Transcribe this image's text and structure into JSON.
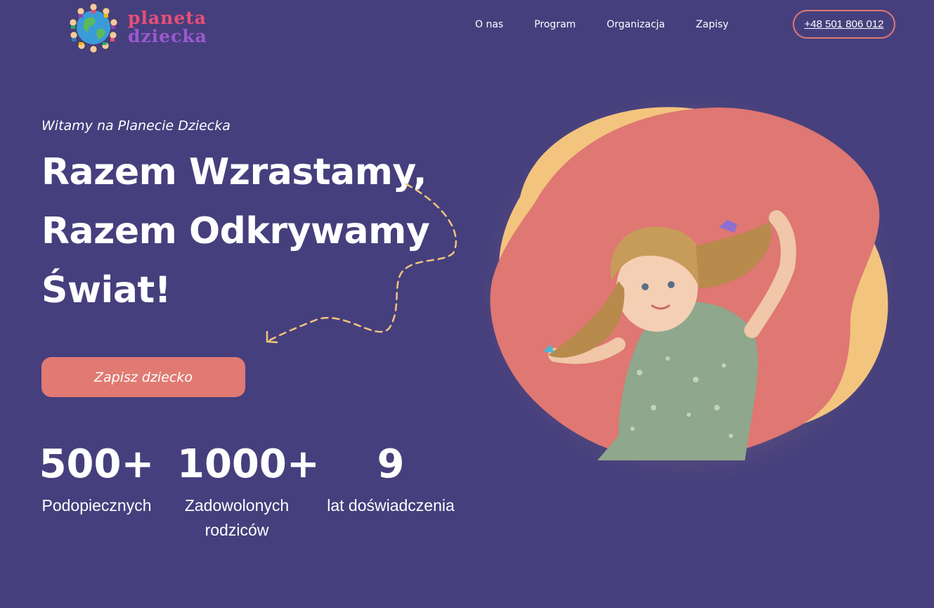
{
  "header": {
    "logo": {
      "line1": "planeta",
      "line2": "dziecka"
    },
    "nav": [
      {
        "label": "O nas"
      },
      {
        "label": "Program"
      },
      {
        "label": "Organizacja"
      },
      {
        "label": "Zapisy"
      }
    ],
    "phone": "+48 501 806 012"
  },
  "hero": {
    "subtitle": "Witamy na Planecie Dziecka",
    "headline_line1": "Razem Wzrastamy,",
    "headline_line2": "Razem Odkrywamy",
    "headline_line3": "Świat!",
    "cta_label": "Zapisz dziecko"
  },
  "stats": [
    {
      "value": "500+",
      "label": "Podopiecznych"
    },
    {
      "value": "1000+",
      "label": "Zadowolonych rodziców"
    },
    {
      "value": "9",
      "label": "lat doświadczenia"
    }
  ],
  "colors": {
    "background": "#463f7d",
    "accent": "#e07a73",
    "yellow": "#f3c47e"
  },
  "icons": [
    "globe-children-logo-icon",
    "dashed-arrow-icon"
  ]
}
